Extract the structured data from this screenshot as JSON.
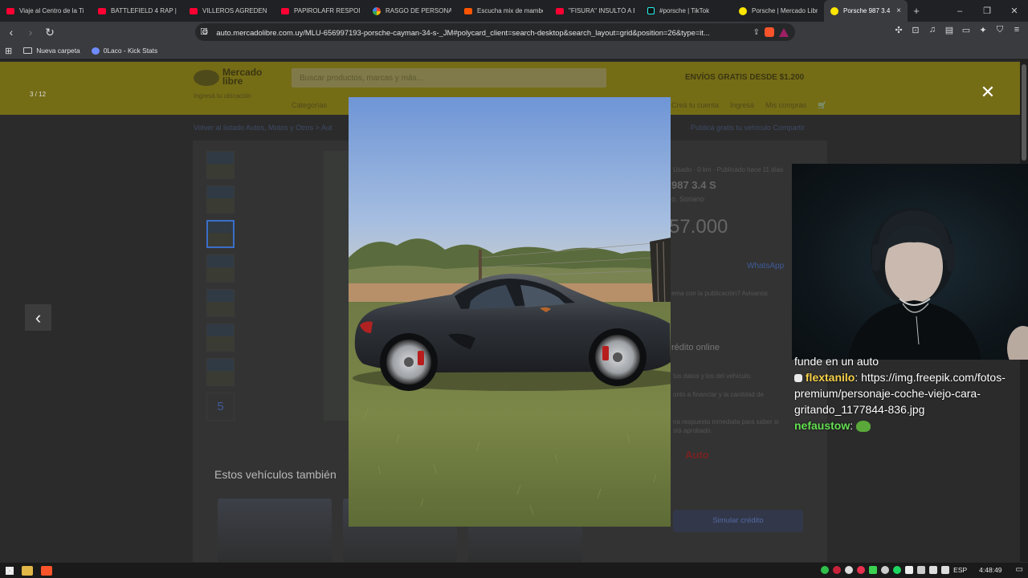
{
  "browser": {
    "tabs": [
      {
        "label": "Viaje al Centro de la Ti",
        "icon": "youtube-icon"
      },
      {
        "label": "BATTLEFIELD 4 RAP | Z",
        "icon": "youtube-icon"
      },
      {
        "label": "VILLEROS AGREDEN a",
        "icon": "youtube-icon"
      },
      {
        "label": "PAPIROLAFR RESPONDE",
        "icon": "youtube-icon"
      },
      {
        "label": "RASGO DE PERSONALIDAD",
        "icon": "google-icon"
      },
      {
        "label": "Escucha mix de mambo",
        "icon": "soundcloud-icon"
      },
      {
        "label": "\"FISURA\" INSULTÓ A B",
        "icon": "youtube-icon"
      },
      {
        "label": "#porsche | TikTok",
        "icon": "tiktok-icon"
      },
      {
        "label": "Porsche | Mercado Libre",
        "icon": "mercadolibre-icon"
      }
    ],
    "active_tab": {
      "label": "Porsche 987 3.4 S",
      "close": "×"
    },
    "new_tab": "+",
    "window_controls": [
      "–",
      "❐",
      "✕"
    ],
    "url": "auto.mercadolibre.com.uy/MLU-656997193-porsche-cayman-34-s-_JM#polycard_client=search-desktop&search_layout=grid&position=26&type=it...",
    "bookmarks": [
      {
        "label": "Nueva carpeta"
      },
      {
        "label": "0Laco - Kick Stats"
      }
    ]
  },
  "page": {
    "logo": "Mercado libre",
    "search_placeholder": "Buscar productos, marcas y más...",
    "shipping_banner": "ENVÍOS GRATIS DESDE $1.200",
    "location": "Ingresá tu ubicación",
    "nav_categories": "Categorías",
    "user_links": [
      "Creá tu cuenta",
      "Ingresá",
      "Mis compras"
    ],
    "breadcrumb_left": "Volver al listado   Autos, Motos y Otros  >  Aut",
    "breadcrumb_right": "Publicá gratis tu vehículo   Compartir",
    "meta": "Usado · 0 km · Publicado hace 11 días",
    "title": "987 3.4 S",
    "location_detail": "o, Soriano",
    "price": "57.000",
    "contact": "WhatsApp",
    "report": "ema con la publicación? Avisanos",
    "credit_title": "rédito online",
    "credit_step1": "tus datos y los del vehículo.",
    "credit_step2": "onto a financiar y la cantidad de",
    "credit_step3": "na respuesta inmediata para saber si",
    "credit_step4": "stá aprobado.",
    "credit_brand": "Auto",
    "simulate": "Simular crédito",
    "related_heading": "Estos vehículos también",
    "more_photos": "5"
  },
  "lightbox": {
    "counter": "3 / 12",
    "prev": "‹",
    "close": "✕"
  },
  "chat": {
    "line0": "funde en un auto",
    "messages": [
      {
        "user": "flextanilo",
        "text": "https://img.freepik.com/fotos-premium/personaje-coche-viejo-cara-gritando_1177844-836.jpg",
        "color": "#f5d04a"
      },
      {
        "user": "nefaustow",
        "text": "",
        "color": "#64e052"
      }
    ]
  },
  "taskbar": {
    "lang": "ESP",
    "time": "4:48:49"
  }
}
